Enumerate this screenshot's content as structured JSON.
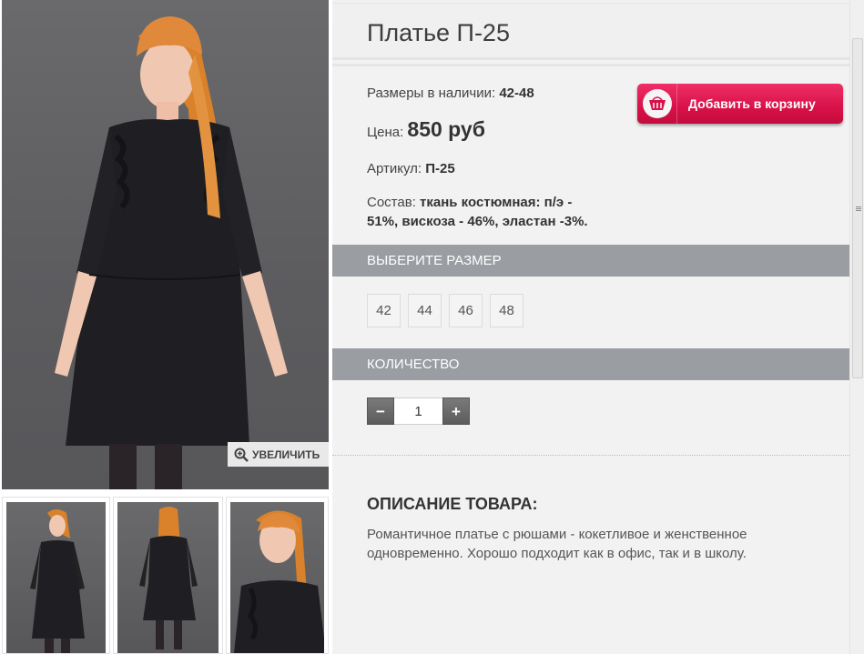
{
  "product": {
    "title": "Платье П-25",
    "sizes_available_label": "Размеры в наличии:",
    "sizes_available_value": "42-48",
    "price_label": "Цена:",
    "price_value": "850 руб",
    "article_label": "Артикул:",
    "article_value": "П-25",
    "composition_label": "Состав:",
    "composition_line1": "ткань костюмная: п/э -",
    "composition_line2": "51%, вискоза - 46%, эластан -3%."
  },
  "cart_button": {
    "label": "Добавить в корзину",
    "icon": "basket-icon",
    "color": "#d81149"
  },
  "zoom_button": {
    "label": "УВЕЛИЧИТЬ",
    "icon": "zoom-in-icon"
  },
  "size_section": {
    "label": "ВЫБЕРИТЕ РАЗМЕР",
    "sizes": [
      "42",
      "44",
      "46",
      "48"
    ]
  },
  "quantity_section": {
    "label": "КОЛИЧЕСТВО",
    "value": "1",
    "minus": "−",
    "plus": "+"
  },
  "description": {
    "title": "ОПИСАНИЕ ТОВАРА:",
    "line1": "Романтичное платье с рюшами - кокетливое и женственное",
    "line2": "одновременно. Хорошо подходит как в офис, так и в школу."
  },
  "gallery": {
    "thumbnails": [
      "front-view",
      "back-view",
      "close-up"
    ]
  },
  "colors": {
    "section_bar": "#9a9da2",
    "accent": "#d81149",
    "panel_bg": "#f2f2f2"
  }
}
